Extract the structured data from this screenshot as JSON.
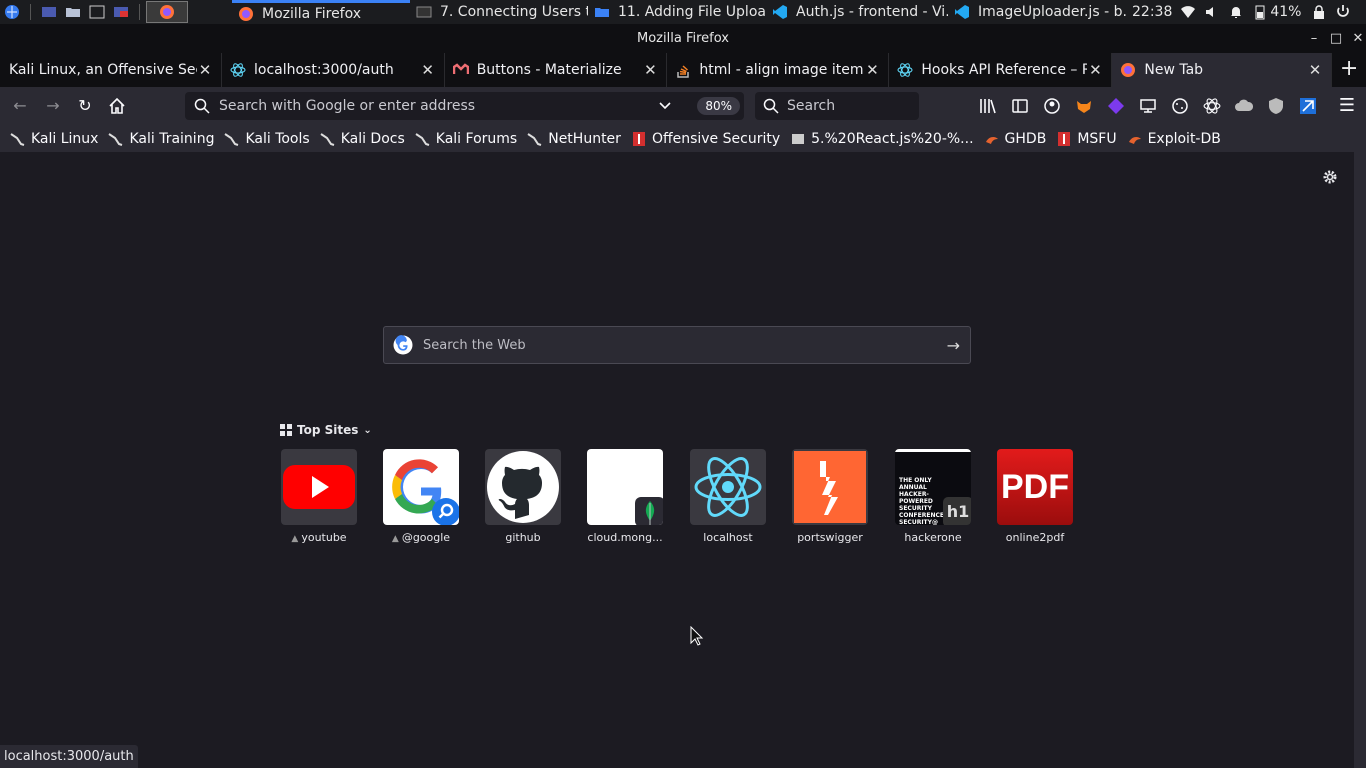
{
  "panel": {
    "tasks": [
      {
        "label": "Mozilla Firefox",
        "active": true
      },
      {
        "label": "7. Connecting Users t..."
      },
      {
        "label": "11. Adding File Uploa..."
      },
      {
        "label": "Auth.js - frontend - Vi..."
      },
      {
        "label": "ImageUploader.js - b..."
      }
    ],
    "clock": "22:38",
    "battery": "41%"
  },
  "window": {
    "title": "Mozilla Firefox"
  },
  "tabs": [
    {
      "label": "Kali Linux, an Offensive Securi"
    },
    {
      "label": "localhost:3000/auth"
    },
    {
      "label": "Buttons - Materialize"
    },
    {
      "label": "html - align image item i"
    },
    {
      "label": "Hooks API Reference – R"
    },
    {
      "label": "New Tab",
      "selected": true
    }
  ],
  "navbar": {
    "url_placeholder": "Search with Google or enter address",
    "zoom": "80%",
    "search_placeholder": "Search"
  },
  "bookmarks": [
    {
      "label": "Kali Linux"
    },
    {
      "label": "Kali Training"
    },
    {
      "label": "Kali Tools"
    },
    {
      "label": "Kali Docs"
    },
    {
      "label": "Kali Forums"
    },
    {
      "label": "NetHunter"
    },
    {
      "label": "Offensive Security"
    },
    {
      "label": "5.%20React.js%20-%..."
    },
    {
      "label": "GHDB"
    },
    {
      "label": "MSFU"
    },
    {
      "label": "Exploit-DB"
    }
  ],
  "newtab": {
    "search_placeholder": "Search the Web",
    "topsites_title": "Top Sites",
    "sites": [
      {
        "label": "youtube",
        "pinned": true
      },
      {
        "label": "@google",
        "pinned": true
      },
      {
        "label": "github"
      },
      {
        "label": "cloud.mong..."
      },
      {
        "label": "localhost"
      },
      {
        "label": "portswigger"
      },
      {
        "label": "hackerone"
      },
      {
        "label": "online2pdf"
      }
    ],
    "hackerone_text": "THE ONLY ANNUAL HACKER-POWERED SECURITY CONFERENCE SECURITY@",
    "pdf_text": "PDF"
  },
  "status": "localhost:3000/auth"
}
